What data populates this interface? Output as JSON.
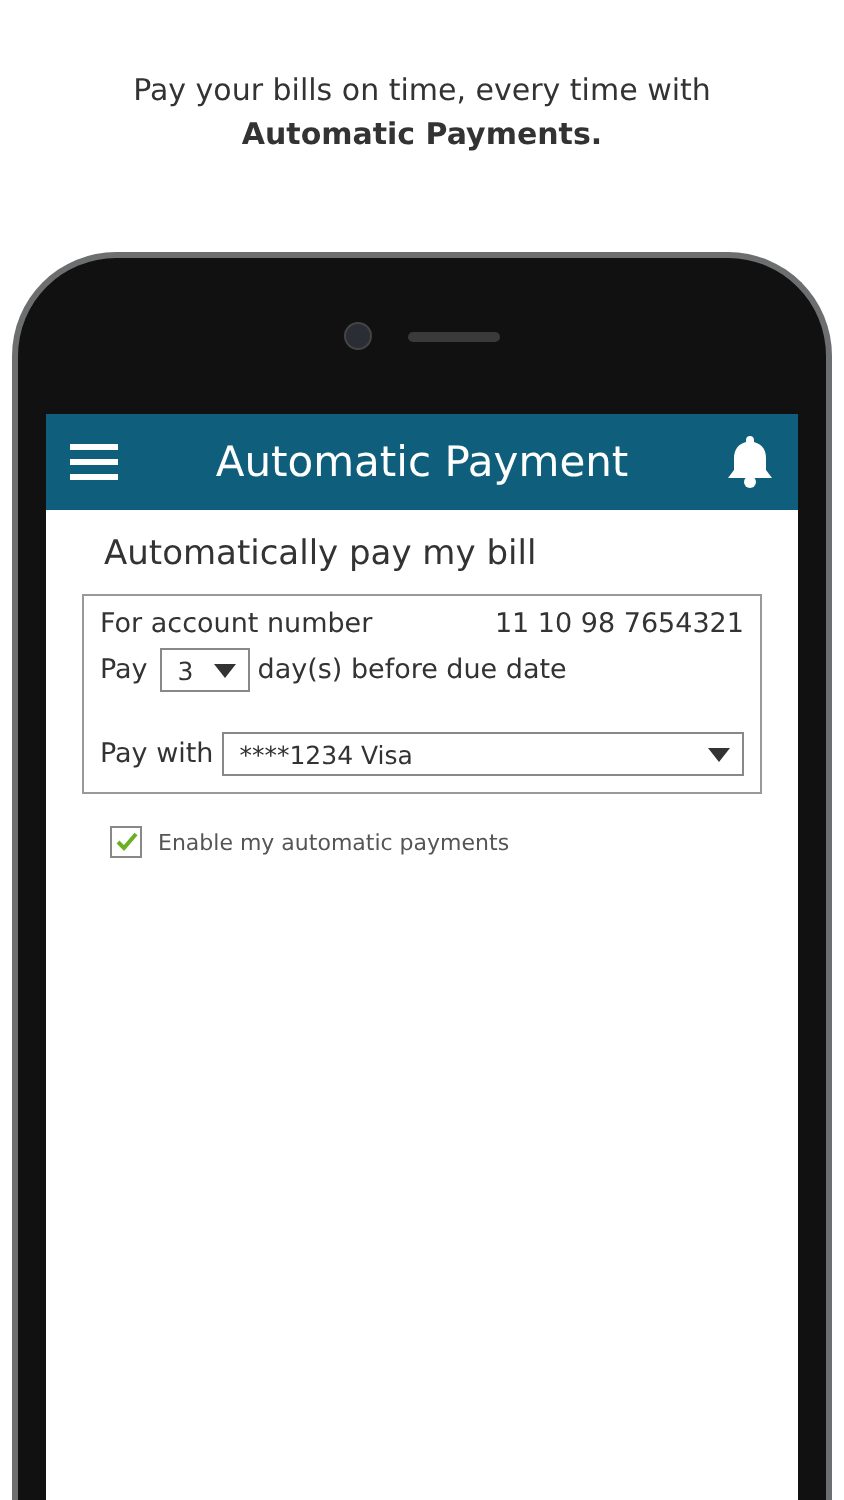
{
  "caption": {
    "text": "Pay your bills on time, every time with",
    "emphasis": "Automatic Payments."
  },
  "header": {
    "title": "Automatic Payment"
  },
  "heading": "Automatically pay my bill",
  "form": {
    "account_label": "For account number",
    "account_number": "11 10 98 7654321",
    "pay_label": "Pay",
    "days_value": "3",
    "days_suffix": "day(s) before due date",
    "pay_with_label": "Pay with",
    "pay_with_value": "****1234 Visa"
  },
  "enable": {
    "label": "Enable my automatic payments",
    "checked": true
  }
}
